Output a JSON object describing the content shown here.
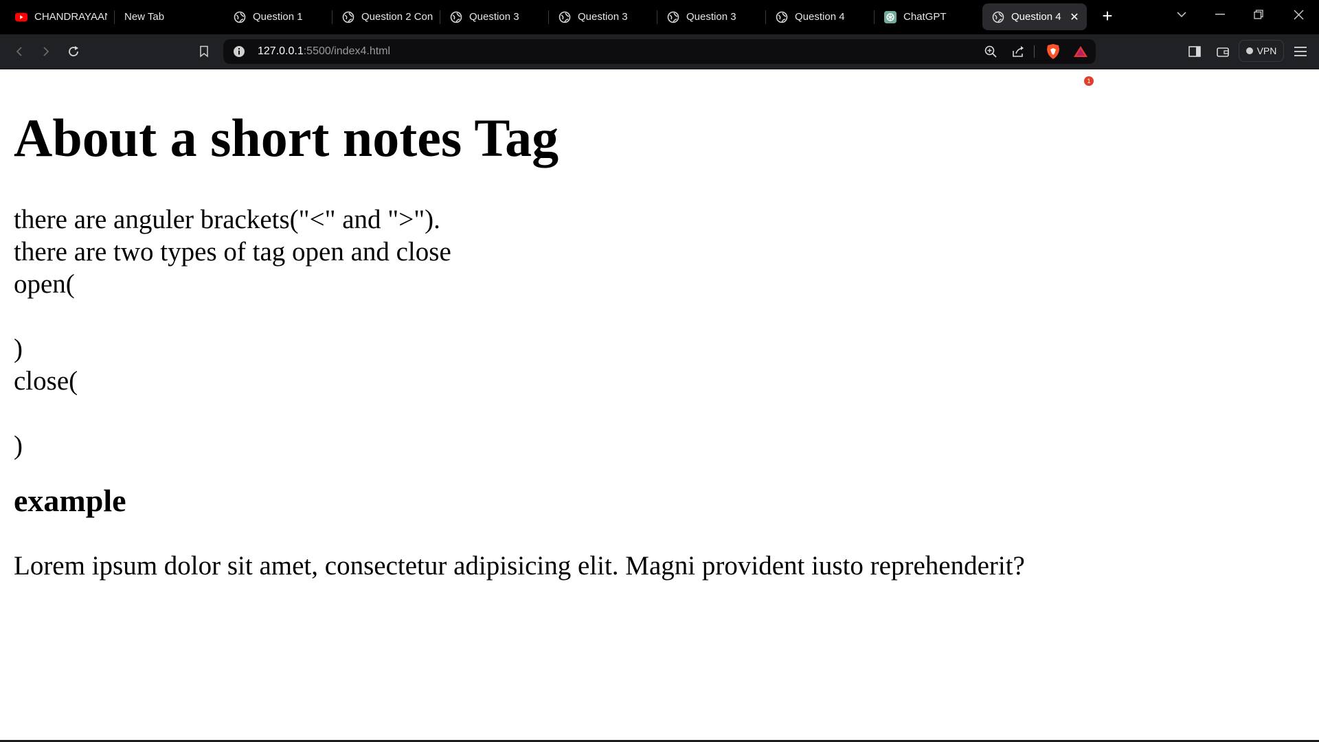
{
  "browser": {
    "tabs": [
      {
        "title": "CHANDRAYAAN",
        "icon": "youtube-icon",
        "active": false
      },
      {
        "title": "New Tab",
        "icon": "none",
        "active": false
      },
      {
        "title": "Question 1",
        "icon": "globe-icon",
        "active": false
      },
      {
        "title": "Question 2 Con",
        "icon": "globe-icon",
        "active": false
      },
      {
        "title": "Question 3",
        "icon": "globe-icon",
        "active": false
      },
      {
        "title": "Question 3",
        "icon": "globe-icon",
        "active": false
      },
      {
        "title": "Question 3",
        "icon": "globe-icon",
        "active": false
      },
      {
        "title": "Question 4",
        "icon": "globe-icon",
        "active": false
      },
      {
        "title": "ChatGPT",
        "icon": "chatgpt-icon",
        "active": false
      },
      {
        "title": "Question 4",
        "icon": "globe-icon",
        "active": true
      }
    ],
    "address": {
      "host": "127.0.0.1",
      "rest": ":5500/index4.html"
    },
    "rewards_badge": "1",
    "vpn_label": "VPN",
    "colors": {
      "tab_strip": "#000000",
      "toolbar": "#202124",
      "omnibox": "#0d0d0f",
      "brave_orange": "#fb542b",
      "youtube_red": "#ff0000"
    }
  },
  "page": {
    "title": "About a short notes Tag",
    "lines": [
      "there are anguler brackets(\"<\" and \">\").",
      "there are two types of tag open and close",
      "open(",
      "",
      ")",
      "close(",
      "",
      ")"
    ],
    "section_heading": "example",
    "paragraph": "Lorem ipsum dolor sit amet, consectetur adipisicing elit. Magni provident iusto reprehenderit?"
  }
}
